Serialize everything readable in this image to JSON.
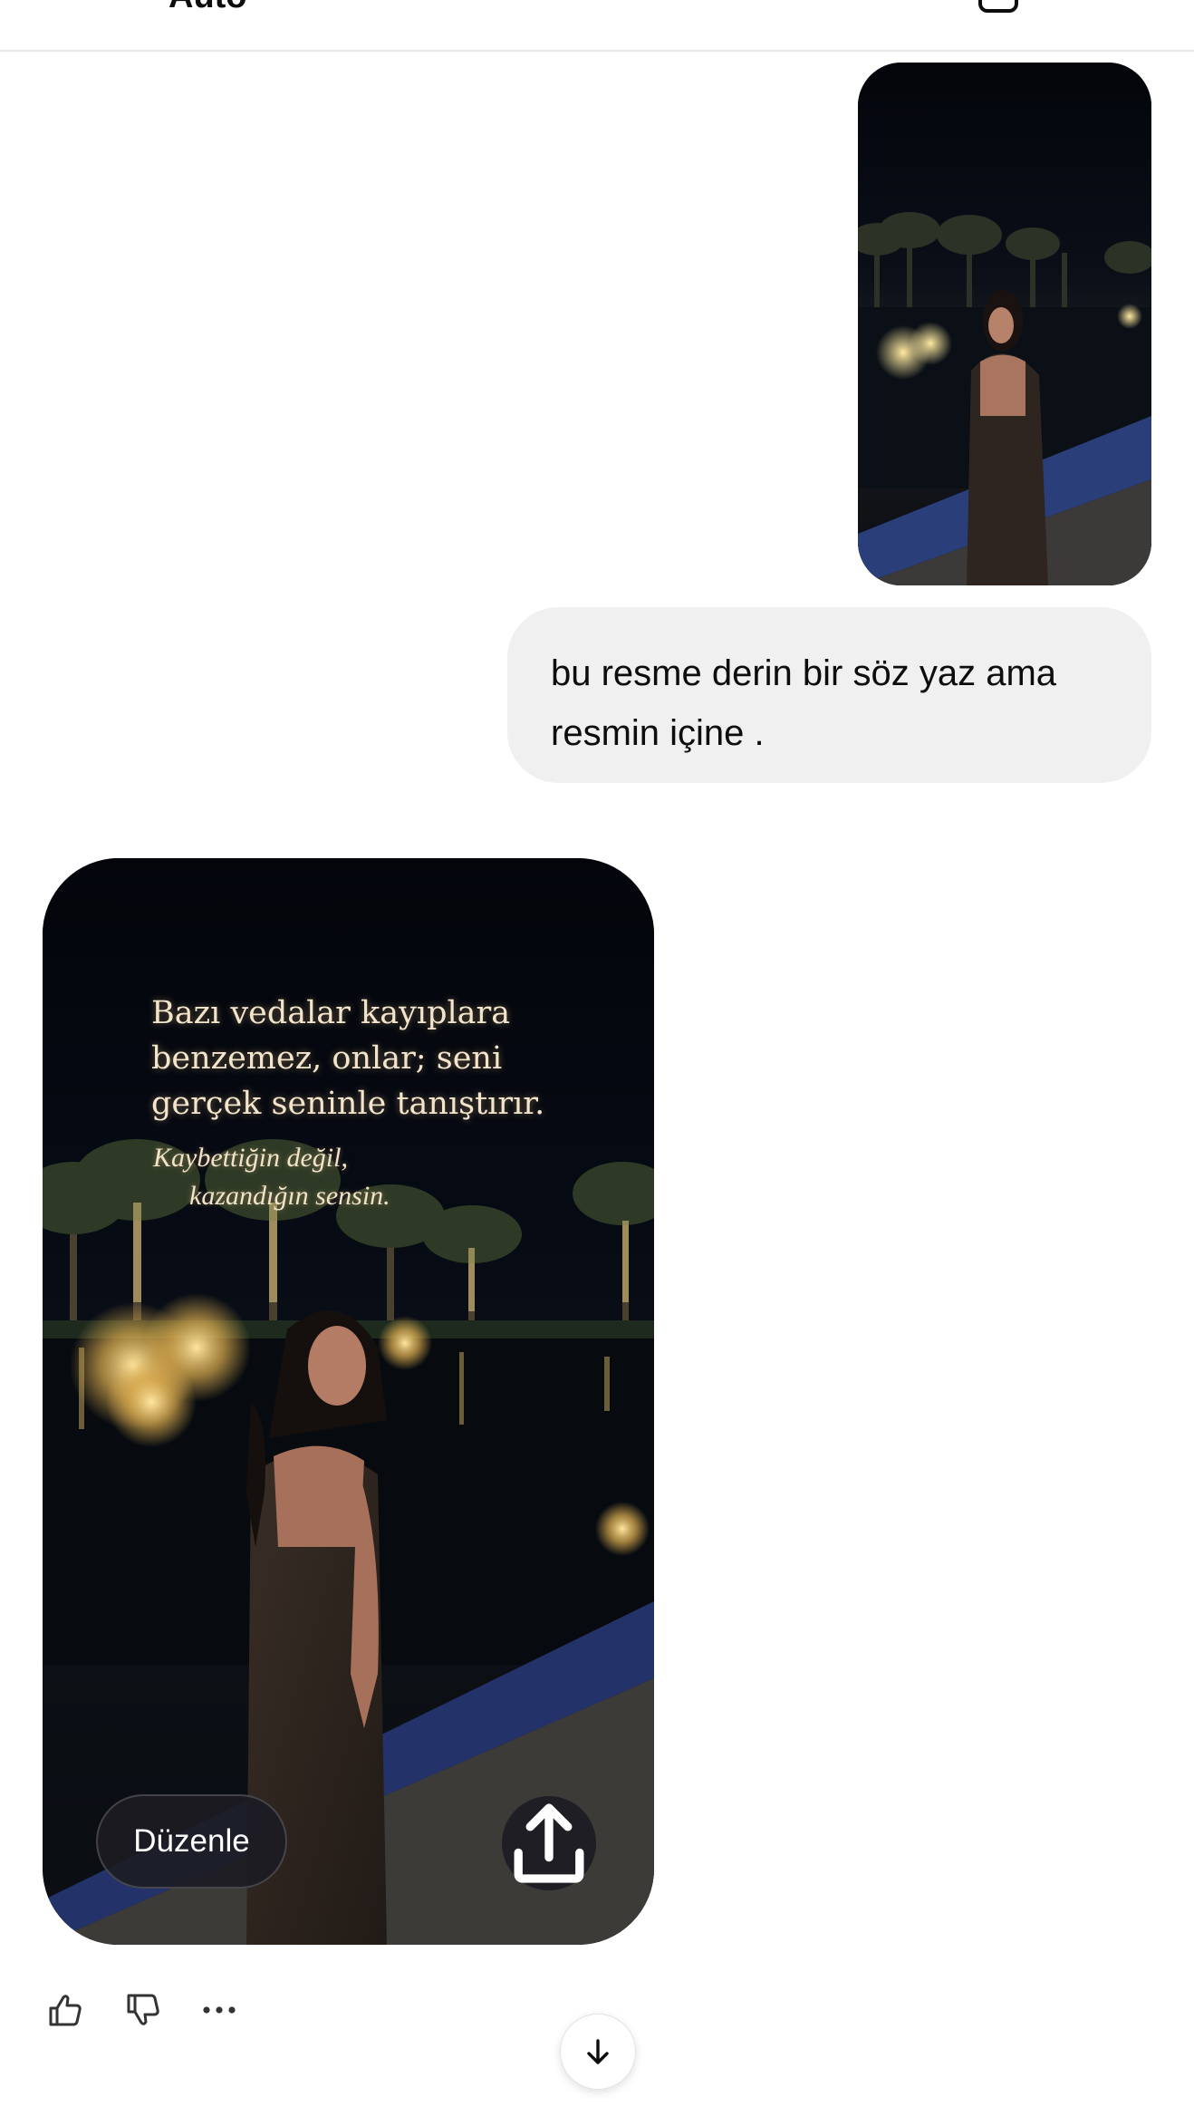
{
  "header": {
    "model_label": "Auto"
  },
  "conversation": {
    "user_message": {
      "text": "bu resme derin bir söz yaz ama resmin içine ."
    },
    "assistant_image": {
      "quote_line1": "Bazı vedalar kayıplara",
      "quote_line2": "benzemez, onlar; seni",
      "quote_line3": "gerçek seninle tanıştırır.",
      "sub_line1": "Kaybettiğin değil,",
      "sub_line2": "kazandığın sensin.",
      "edit_label": "Düzenle"
    }
  },
  "icons": {
    "menu": "hamburger-menu-icon",
    "new_chat": "new-chat-icon",
    "share": "share-upload-icon",
    "like": "thumbs-up-icon",
    "dislike": "thumbs-down-icon",
    "more": "more-dots-icon",
    "scroll": "arrow-down-icon"
  },
  "colors": {
    "user_bubble": "#f0f0f0",
    "overlay_button": "#1c1c22",
    "quote_text": "#f3e5cc"
  }
}
